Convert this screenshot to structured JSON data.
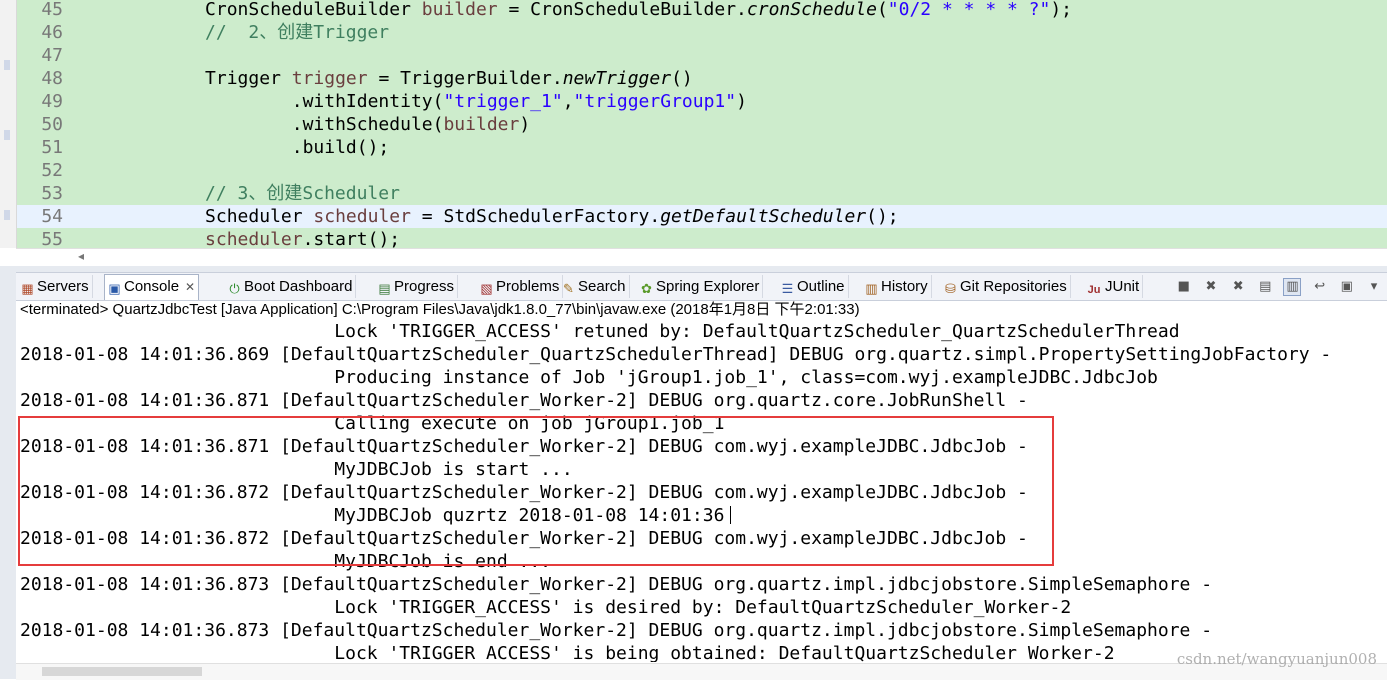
{
  "editor": {
    "lines": [
      {
        "num": "45",
        "parts": [
          {
            "t": "            CronScheduleBuilder ",
            "c": "kw"
          },
          {
            "t": "builder",
            "c": "ident"
          },
          {
            "t": " = CronScheduleBuilder.",
            "c": "kw"
          },
          {
            "t": "cronSchedule",
            "c": "kw ital"
          },
          {
            "t": "(",
            "c": "kw"
          },
          {
            "t": "\"0/2 * * * * ?\"",
            "c": "str"
          },
          {
            "t": ");",
            "c": "kw"
          }
        ]
      },
      {
        "num": "46",
        "parts": [
          {
            "t": "            //  2、创建Trigger",
            "c": "cmt"
          }
        ]
      },
      {
        "num": "47",
        "parts": []
      },
      {
        "num": "48",
        "parts": [
          {
            "t": "            Trigger ",
            "c": "kw"
          },
          {
            "t": "trigger",
            "c": "ident"
          },
          {
            "t": " = TriggerBuilder.",
            "c": "kw"
          },
          {
            "t": "newTrigger",
            "c": "kw ital"
          },
          {
            "t": "()",
            "c": "kw"
          }
        ]
      },
      {
        "num": "49",
        "parts": [
          {
            "t": "                    .withIdentity(",
            "c": "kw"
          },
          {
            "t": "\"trigger_1\"",
            "c": "str"
          },
          {
            "t": ",",
            "c": "kw"
          },
          {
            "t": "\"triggerGroup1\"",
            "c": "str"
          },
          {
            "t": ")",
            "c": "kw"
          }
        ]
      },
      {
        "num": "50",
        "parts": [
          {
            "t": "                    .withSchedule(",
            "c": "kw"
          },
          {
            "t": "builder",
            "c": "ident"
          },
          {
            "t": ")",
            "c": "kw"
          }
        ]
      },
      {
        "num": "51",
        "parts": [
          {
            "t": "                    .build();",
            "c": "kw"
          }
        ]
      },
      {
        "num": "52",
        "parts": []
      },
      {
        "num": "53",
        "parts": [
          {
            "t": "            // 3、创建Scheduler",
            "c": "cmt"
          }
        ]
      },
      {
        "num": "54",
        "current": true,
        "parts": [
          {
            "t": "            Scheduler ",
            "c": "kw"
          },
          {
            "t": "scheduler",
            "c": "ident"
          },
          {
            "t": " = StdSchedulerFactory.",
            "c": "kw"
          },
          {
            "t": "getDefaultScheduler",
            "c": "kw ital"
          },
          {
            "t": "();",
            "c": "kw"
          }
        ]
      },
      {
        "num": "55",
        "parts": [
          {
            "t": "            ",
            "c": "kw"
          },
          {
            "t": "scheduler",
            "c": "ident"
          },
          {
            "t": ".start();",
            "c": "kw"
          }
        ]
      }
    ]
  },
  "tabs": [
    {
      "label": "Servers",
      "icon": "servers-icon",
      "glyph": "▦",
      "color": "#b04a2a"
    },
    {
      "label": "Console",
      "icon": "console-icon",
      "glyph": "▣",
      "color": "#2b5aa8",
      "active": true
    },
    {
      "label": "Boot Dashboard",
      "icon": "boot-dashboard-icon",
      "glyph": "⏻",
      "color": "#2a8a2a"
    },
    {
      "label": "Progress",
      "icon": "progress-icon",
      "glyph": "▤",
      "color": "#3a7a3a"
    },
    {
      "label": "Problems",
      "icon": "problems-icon",
      "glyph": "▧",
      "color": "#a03030"
    },
    {
      "label": "Search",
      "icon": "search-icon",
      "glyph": "✎",
      "color": "#a07020"
    },
    {
      "label": "Spring Explorer",
      "icon": "spring-explorer-icon",
      "glyph": "✿",
      "color": "#5a9a2a"
    },
    {
      "label": "Outline",
      "icon": "outline-icon",
      "glyph": "☰",
      "color": "#3a5aa0"
    },
    {
      "label": "History",
      "icon": "history-icon",
      "glyph": "▥",
      "color": "#a06020"
    },
    {
      "label": "Git Repositories",
      "icon": "git-repositories-icon",
      "glyph": "⛁",
      "color": "#a06020"
    },
    {
      "label": "JUnit",
      "icon": "junit-icon",
      "glyph": "Ju",
      "color": "#a03030"
    }
  ],
  "console": {
    "header": "<terminated> QuartzJdbcTest [Java Application] C:\\Program Files\\Java\\jdk1.8.0_77\\bin\\javaw.exe (2018年1月8日 下午2:01:33)",
    "lines": [
      "                             Lock 'TRIGGER_ACCESS' retuned by: DefaultQuartzScheduler_QuartzSchedulerThread",
      "2018-01-08 14:01:36.869 [DefaultQuartzScheduler_QuartzSchedulerThread] DEBUG org.quartz.simpl.PropertySettingJobFactory -",
      "                             Producing instance of Job 'jGroup1.job_1', class=com.wyj.exampleJDBC.JdbcJob",
      "2018-01-08 14:01:36.871 [DefaultQuartzScheduler_Worker-2] DEBUG org.quartz.core.JobRunShell -",
      "                             Calling execute on job jGroup1.job_1",
      "2018-01-08 14:01:36.871 [DefaultQuartzScheduler_Worker-2] DEBUG com.wyj.exampleJDBC.JdbcJob -",
      "                             MyJDBCJob is start ...",
      "2018-01-08 14:01:36.872 [DefaultQuartzScheduler_Worker-2] DEBUG com.wyj.exampleJDBC.JdbcJob -",
      "                             MyJDBCJob quzrtz 2018-01-08 14:01:36",
      "2018-01-08 14:01:36.872 [DefaultQuartzScheduler_Worker-2] DEBUG com.wyj.exampleJDBC.JdbcJob -",
      "                             MyJDBCJob is end ...",
      "2018-01-08 14:01:36.873 [DefaultQuartzScheduler_Worker-2] DEBUG org.quartz.impl.jdbcjobstore.SimpleSemaphore -",
      "                             Lock 'TRIGGER_ACCESS' is desired by: DefaultQuartzScheduler_Worker-2",
      "2018-01-08 14:01:36.873 [DefaultQuartzScheduler_Worker-2] DEBUG org.quartz.impl.jdbcjobstore.SimpleSemaphore -",
      "                             Lock 'TRIGGER_ACCESS' is being obtained: DefaultQuartzScheduler_Worker-2"
    ]
  },
  "watermark": "csdn.net/wangyuanjun008",
  "colors": {
    "highlight_box": "#e53c3c",
    "editor_bg": "#cdeccc",
    "string": "#2a00ff",
    "comment": "#3f7f5f"
  }
}
